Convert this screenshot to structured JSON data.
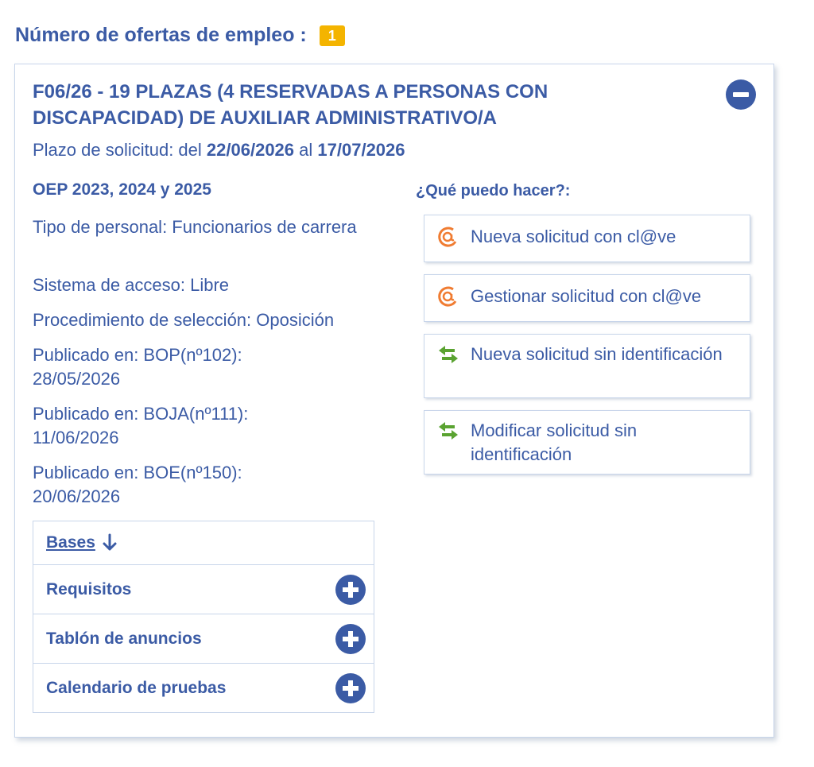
{
  "header": {
    "title": "Número de ofertas de empleo :",
    "count": "1"
  },
  "offer": {
    "title": "F06/26 - 19 PLAZAS (4 RESERVADAS A PERSONAS CON DISCAPACIDAD) DE AUXILIAR ADMINISTRATIVO/A",
    "deadline": {
      "prefix": "Plazo de solicitud: del",
      "start": "22/06/2026",
      "middle": "al",
      "end": "17/07/2026"
    },
    "oep": "OEP 2023, 2024 y 2025",
    "details": [
      "Tipo de personal: Funcionarios de carrera",
      "Sistema de acceso: Libre",
      "Procedimiento de selección: Oposición",
      "Publicado en: BOP(nº102): 28/05/2026",
      "Publicado en: BOJA(nº111): 11/06/2026",
      "Publicado en: BOE(nº150): 20/06/2026"
    ],
    "actions_title": "¿Qué puedo hacer?:",
    "actions": [
      {
        "label": "Nueva solicitud con cl@ve",
        "icon": "clave-at-icon"
      },
      {
        "label": "Gestionar solicitud con cl@ve",
        "icon": "clave-at-icon"
      },
      {
        "label": "Nueva solicitud sin identificación",
        "icon": "exchange-arrows-icon"
      },
      {
        "label": "Modificar solicitud sin identificación",
        "icon": "exchange-arrows-icon"
      }
    ],
    "sections": {
      "bases": "Bases",
      "requisitos": "Requisitos",
      "tablon": "Tablón de anuncios",
      "calendario": "Calendario de pruebas"
    }
  },
  "colors": {
    "primary": "#3b5ba5",
    "badge": "#f4b400",
    "clave_icon": "#f07c32",
    "exchange_icon": "#5aa331"
  }
}
